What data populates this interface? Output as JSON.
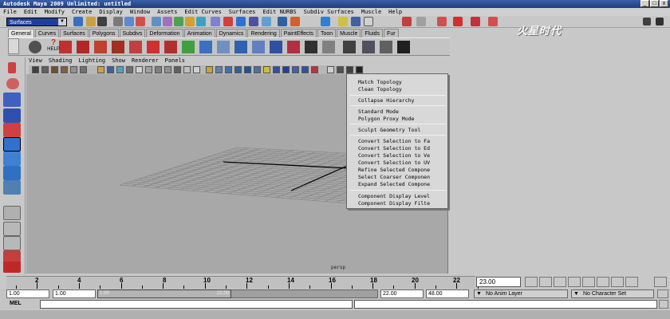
{
  "window": {
    "title": "Autodesk Maya 2009 Unlimited: untitled",
    "min": "_",
    "max": "□",
    "close": "x"
  },
  "menubar": [
    "File",
    "Edit",
    "Modify",
    "Create",
    "Display",
    "Window",
    "Assets",
    "Edit Curves",
    "Surfaces",
    "Edit NURBS",
    "Subdiv Surfaces",
    "Muscle",
    "Help"
  ],
  "status_line": {
    "menu_set": "Surfaces"
  },
  "shelf_tabs": [
    "General",
    "Curves",
    "Surfaces",
    "Polygons",
    "Subdivs",
    "Deformation",
    "Animation",
    "Dynamics",
    "Rendering",
    "PaintEffects",
    "Toon",
    "Muscle",
    "Fluids",
    "Fur"
  ],
  "shelf_tab_active": "General",
  "shelf": {
    "help_label": "HELP"
  },
  "watermark_text": "火星时代",
  "panel_menu": [
    "View",
    "Shading",
    "Lighting",
    "Show",
    "Renderer",
    "Panels"
  ],
  "viewport": {
    "camera_label": "persp",
    "background": "#a8a8a8",
    "grid_color": "#7a7a7a"
  },
  "edit_mesh_menu": [
    "Match Topology",
    "Clean Topology",
    "Collapse Hierarchy",
    "Standard Mode",
    "Polygon Proxy Mode",
    "Sculpt Geometry Tool",
    "Convert Selection to Fa",
    "Convert Selection to Ed",
    "Convert Selection to Ve",
    "Convert Selection to UV",
    "Refine Selected Compone",
    "Select Coarser Componen",
    "Expand Selected Compone",
    "Component Display Level",
    "Component Display Filte"
  ],
  "time_slider": {
    "labels": [
      "2",
      "4",
      "6",
      "8",
      "10",
      "12",
      "14",
      "16",
      "18",
      "20",
      "22"
    ],
    "current_frame": "23.00"
  },
  "range_slider": {
    "start_time": "1.00",
    "playback_start": "1.00",
    "playback_end": "22.00",
    "end_time": "48.00",
    "range_left": "1.00",
    "range_right": "22.00",
    "anim_layer": "No Anim Layer",
    "character_set": "No Character Set"
  },
  "command_line": {
    "label": "MEL",
    "value": ""
  },
  "colors": {
    "titlebar": "#1d3c7c",
    "menu_set_bg": "#1f3f9a",
    "ui_gray": "#c8c8c8"
  }
}
